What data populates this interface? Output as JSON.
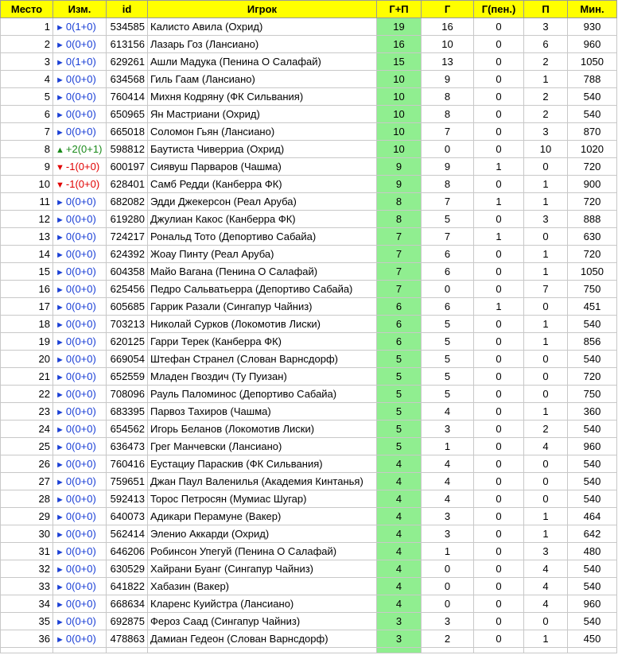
{
  "headers": {
    "place": "Место",
    "change": "Изм.",
    "id": "id",
    "player": "Игрок",
    "gp": "Г+П",
    "g": "Г",
    "gpen": "Г(пен.)",
    "p": "П",
    "min": "Мин."
  },
  "rows": [
    {
      "place": "1",
      "arrow": "►",
      "dir": "same",
      "change": "0(1+0)",
      "id": "534585",
      "player": "Калисто Авила (Охрид)",
      "gp": "19",
      "g": "16",
      "gpen": "0",
      "p": "3",
      "min": "930"
    },
    {
      "place": "2",
      "arrow": "►",
      "dir": "same",
      "change": "0(0+0)",
      "id": "613156",
      "player": "Лазарь Гоз (Лансиано)",
      "gp": "16",
      "g": "10",
      "gpen": "0",
      "p": "6",
      "min": "960"
    },
    {
      "place": "3",
      "arrow": "►",
      "dir": "same",
      "change": "0(1+0)",
      "id": "629261",
      "player": "Ашли Мадука (Пенина О Салафай)",
      "gp": "15",
      "g": "13",
      "gpen": "0",
      "p": "2",
      "min": "1050"
    },
    {
      "place": "4",
      "arrow": "►",
      "dir": "same",
      "change": "0(0+0)",
      "id": "634568",
      "player": "Гиль Гаам (Лансиано)",
      "gp": "10",
      "g": "9",
      "gpen": "0",
      "p": "1",
      "min": "788"
    },
    {
      "place": "5",
      "arrow": "►",
      "dir": "same",
      "change": "0(0+0)",
      "id": "760414",
      "player": "Михня Кодряну (ФК Сильвания)",
      "gp": "10",
      "g": "8",
      "gpen": "0",
      "p": "2",
      "min": "540"
    },
    {
      "place": "6",
      "arrow": "►",
      "dir": "same",
      "change": "0(0+0)",
      "id": "650965",
      "player": "Ян Мастриани (Охрид)",
      "gp": "10",
      "g": "8",
      "gpen": "0",
      "p": "2",
      "min": "540"
    },
    {
      "place": "7",
      "arrow": "►",
      "dir": "same",
      "change": "0(0+0)",
      "id": "665018",
      "player": "Соломон Гьян (Лансиано)",
      "gp": "10",
      "g": "7",
      "gpen": "0",
      "p": "3",
      "min": "870"
    },
    {
      "place": "8",
      "arrow": "▲",
      "dir": "up",
      "change": "+2(0+1)",
      "id": "598812",
      "player": "Баутиста Чиверриа (Охрид)",
      "gp": "10",
      "g": "0",
      "gpen": "0",
      "p": "10",
      "min": "1020"
    },
    {
      "place": "9",
      "arrow": "▼",
      "dir": "down",
      "change": "-1(0+0)",
      "id": "600197",
      "player": "Сиявуш Парваров (Чашма)",
      "gp": "9",
      "g": "9",
      "gpen": "1",
      "p": "0",
      "min": "720"
    },
    {
      "place": "10",
      "arrow": "▼",
      "dir": "down",
      "change": "-1(0+0)",
      "id": "628401",
      "player": "Самб Редди (Канберра ФК)",
      "gp": "9",
      "g": "8",
      "gpen": "0",
      "p": "1",
      "min": "900"
    },
    {
      "place": "11",
      "arrow": "►",
      "dir": "same",
      "change": "0(0+0)",
      "id": "682082",
      "player": "Эдди Джекерсон (Реал Аруба)",
      "gp": "8",
      "g": "7",
      "gpen": "1",
      "p": "1",
      "min": "720"
    },
    {
      "place": "12",
      "arrow": "►",
      "dir": "same",
      "change": "0(0+0)",
      "id": "619280",
      "player": "Джулиан Какос (Канберра ФК)",
      "gp": "8",
      "g": "5",
      "gpen": "0",
      "p": "3",
      "min": "888"
    },
    {
      "place": "13",
      "arrow": "►",
      "dir": "same",
      "change": "0(0+0)",
      "id": "724217",
      "player": "Рональд Тото (Депортиво Сабайа)",
      "gp": "7",
      "g": "7",
      "gpen": "1",
      "p": "0",
      "min": "630"
    },
    {
      "place": "14",
      "arrow": "►",
      "dir": "same",
      "change": "0(0+0)",
      "id": "624392",
      "player": "Жоау Пинту (Реал Аруба)",
      "gp": "7",
      "g": "6",
      "gpen": "0",
      "p": "1",
      "min": "720"
    },
    {
      "place": "15",
      "arrow": "►",
      "dir": "same",
      "change": "0(0+0)",
      "id": "604358",
      "player": "Майо Вагана (Пенина О Салафай)",
      "gp": "7",
      "g": "6",
      "gpen": "0",
      "p": "1",
      "min": "1050"
    },
    {
      "place": "16",
      "arrow": "►",
      "dir": "same",
      "change": "0(0+0)",
      "id": "625456",
      "player": "Педро Сальватьерра (Депортиво Сабайа)",
      "gp": "7",
      "g": "0",
      "gpen": "0",
      "p": "7",
      "min": "750"
    },
    {
      "place": "17",
      "arrow": "►",
      "dir": "same",
      "change": "0(0+0)",
      "id": "605685",
      "player": "Гаррик Разали (Сингапур Чайниз)",
      "gp": "6",
      "g": "6",
      "gpen": "1",
      "p": "0",
      "min": "451"
    },
    {
      "place": "18",
      "arrow": "►",
      "dir": "same",
      "change": "0(0+0)",
      "id": "703213",
      "player": "Николай Сурков (Локомотив Лиски)",
      "gp": "6",
      "g": "5",
      "gpen": "0",
      "p": "1",
      "min": "540"
    },
    {
      "place": "19",
      "arrow": "►",
      "dir": "same",
      "change": "0(0+0)",
      "id": "620125",
      "player": "Гарри Терек (Канберра ФК)",
      "gp": "6",
      "g": "5",
      "gpen": "0",
      "p": "1",
      "min": "856"
    },
    {
      "place": "20",
      "arrow": "►",
      "dir": "same",
      "change": "0(0+0)",
      "id": "669054",
      "player": "Штефан Странел (Слован Варнсдорф)",
      "gp": "5",
      "g": "5",
      "gpen": "0",
      "p": "0",
      "min": "540"
    },
    {
      "place": "21",
      "arrow": "►",
      "dir": "same",
      "change": "0(0+0)",
      "id": "652559",
      "player": "Младен Гвоздич (Ту Пуизан)",
      "gp": "5",
      "g": "5",
      "gpen": "0",
      "p": "0",
      "min": "720"
    },
    {
      "place": "22",
      "arrow": "►",
      "dir": "same",
      "change": "0(0+0)",
      "id": "708096",
      "player": "Рауль Паломинос (Депортиво Сабайа)",
      "gp": "5",
      "g": "5",
      "gpen": "0",
      "p": "0",
      "min": "750"
    },
    {
      "place": "23",
      "arrow": "►",
      "dir": "same",
      "change": "0(0+0)",
      "id": "683395",
      "player": "Парвоз Тахиров (Чашма)",
      "gp": "5",
      "g": "4",
      "gpen": "0",
      "p": "1",
      "min": "360"
    },
    {
      "place": "24",
      "arrow": "►",
      "dir": "same",
      "change": "0(0+0)",
      "id": "654562",
      "player": "Игорь Беланов (Локомотив Лиски)",
      "gp": "5",
      "g": "3",
      "gpen": "0",
      "p": "2",
      "min": "540"
    },
    {
      "place": "25",
      "arrow": "►",
      "dir": "same",
      "change": "0(0+0)",
      "id": "636473",
      "player": "Грег Манчевски (Лансиано)",
      "gp": "5",
      "g": "1",
      "gpen": "0",
      "p": "4",
      "min": "960"
    },
    {
      "place": "26",
      "arrow": "►",
      "dir": "same",
      "change": "0(0+0)",
      "id": "760416",
      "player": "Еустациу Параскив (ФК Сильвания)",
      "gp": "4",
      "g": "4",
      "gpen": "0",
      "p": "0",
      "min": "540"
    },
    {
      "place": "27",
      "arrow": "►",
      "dir": "same",
      "change": "0(0+0)",
      "id": "759651",
      "player": "Джан Паул Валенилья (Академия Кинтанья)",
      "gp": "4",
      "g": "4",
      "gpen": "0",
      "p": "0",
      "min": "540"
    },
    {
      "place": "28",
      "arrow": "►",
      "dir": "same",
      "change": "0(0+0)",
      "id": "592413",
      "player": "Торос Петросян (Мумиас Шугар)",
      "gp": "4",
      "g": "4",
      "gpen": "0",
      "p": "0",
      "min": "540"
    },
    {
      "place": "29",
      "arrow": "►",
      "dir": "same",
      "change": "0(0+0)",
      "id": "640073",
      "player": "Адикари Перамуне (Вакер)",
      "gp": "4",
      "g": "3",
      "gpen": "0",
      "p": "1",
      "min": "464"
    },
    {
      "place": "30",
      "arrow": "►",
      "dir": "same",
      "change": "0(0+0)",
      "id": "562414",
      "player": "Эленио Аккарди (Охрид)",
      "gp": "4",
      "g": "3",
      "gpen": "0",
      "p": "1",
      "min": "642"
    },
    {
      "place": "31",
      "arrow": "►",
      "dir": "same",
      "change": "0(0+0)",
      "id": "646206",
      "player": "Робинсон Упегуй (Пенина О Салафай)",
      "gp": "4",
      "g": "1",
      "gpen": "0",
      "p": "3",
      "min": "480"
    },
    {
      "place": "32",
      "arrow": "►",
      "dir": "same",
      "change": "0(0+0)",
      "id": "630529",
      "player": "Хайрани Буанг (Сингапур Чайниз)",
      "gp": "4",
      "g": "0",
      "gpen": "0",
      "p": "4",
      "min": "540"
    },
    {
      "place": "33",
      "arrow": "►",
      "dir": "same",
      "change": "0(0+0)",
      "id": "641822",
      "player": "Хабазин (Вакер)",
      "gp": "4",
      "g": "0",
      "gpen": "0",
      "p": "4",
      "min": "540"
    },
    {
      "place": "34",
      "arrow": "►",
      "dir": "same",
      "change": "0(0+0)",
      "id": "668634",
      "player": "Кларенс Куийстра (Лансиано)",
      "gp": "4",
      "g": "0",
      "gpen": "0",
      "p": "4",
      "min": "960"
    },
    {
      "place": "35",
      "arrow": "►",
      "dir": "same",
      "change": "0(0+0)",
      "id": "692875",
      "player": "Фероз Саад (Сингапур Чайниз)",
      "gp": "3",
      "g": "3",
      "gpen": "0",
      "p": "0",
      "min": "540"
    },
    {
      "place": "36",
      "arrow": "►",
      "dir": "same",
      "change": "0(0+0)",
      "id": "478863",
      "player": "Дамиан Гедеон (Слован Варнсдорф)",
      "gp": "3",
      "g": "2",
      "gpen": "0",
      "p": "1",
      "min": "450"
    }
  ]
}
